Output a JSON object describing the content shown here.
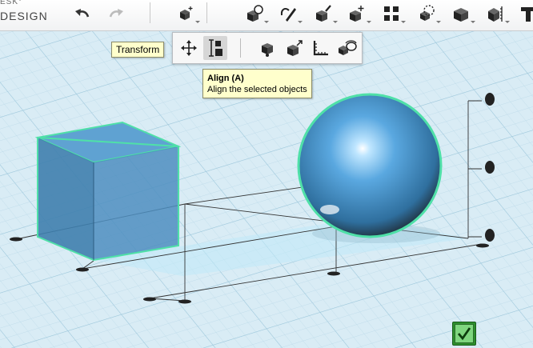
{
  "app": {
    "logo_line1": "ESK°",
    "logo_line2": "DESIGN"
  },
  "tooltips": {
    "transform": "Transform",
    "align_title": "Align (A)",
    "align_desc": "Align the selected objects"
  },
  "toolbar_icons": [
    "undo-icon",
    "redo-icon",
    "transform-icon",
    "primitives-icon",
    "sketch-icon",
    "construct-icon",
    "modify-icon",
    "pattern-icon",
    "grouping-icon",
    "combine-icon",
    "measure-icon",
    "text-icon"
  ],
  "flyout_icons": [
    "move-icon",
    "align-icon",
    "scale-icon",
    "smart-scale-icon",
    "ruler-icon",
    "snap-icon"
  ],
  "colors": {
    "grid_bg": "#d9ecf5",
    "object_blue": "#4a8ec0",
    "selection_outline": "#4fe0a8",
    "confirm_green": "#2d8e2d"
  }
}
